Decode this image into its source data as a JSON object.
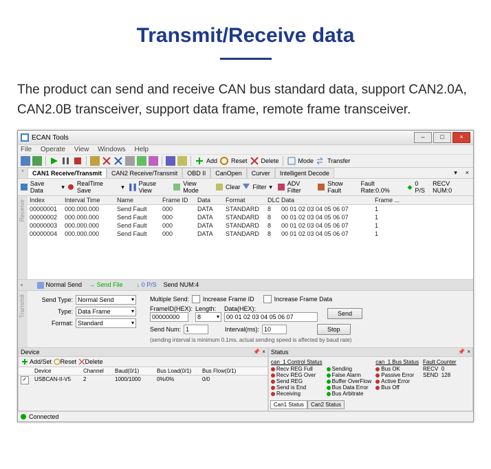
{
  "page": {
    "title": "Transmit/Receive data",
    "desc": "The product can send and receive CAN bus standard data, support CAN2.0A, CAN2.0B transceiver, support data frame, remote frame transceiver."
  },
  "window": {
    "title": "ECAN Tools"
  },
  "menu": [
    "File",
    "Operate",
    "View",
    "Windows",
    "Help"
  ],
  "toolbar": {
    "add": "Add",
    "reset": "Reset",
    "delete": "Delete",
    "mode": "Mode",
    "transfer": "Transfer"
  },
  "maintabs": [
    "CAN1 Receive/Transmit",
    "CAN2 Receive/Transmit",
    "OBD II",
    "CanOpen",
    "Curver",
    "Intelligent Decode"
  ],
  "tb2": {
    "save": "Save Data",
    "rtsave": "RealTime Save",
    "pause": "Pause View",
    "viewmode": "View Mode",
    "clear": "Clear",
    "filter": "Filter",
    "adv": "ADV Filter",
    "showfault": "Show Fault",
    "faultrate": "Fault Rate:0.0%",
    "ps": "0 P/S",
    "recv": "RECV NUM:0"
  },
  "gridhdr": [
    "Index",
    "Interval Time",
    "Name",
    "Frame ID",
    "Data",
    "Format",
    "DLC",
    "Data",
    "Frame ..."
  ],
  "rows": [
    {
      "idx": "00000001",
      "time": "000.000.000",
      "name": "Send Fault",
      "fid": "000",
      "data1": "DATA",
      "fmt": "STANDARD",
      "dlc": "8",
      "data2": "00 01 02 03 04 05 06 07",
      "frame": "1"
    },
    {
      "idx": "00000002",
      "time": "000.000.000",
      "name": "Send Fault",
      "fid": "000",
      "data1": "DATA",
      "fmt": "STANDARD",
      "dlc": "8",
      "data2": "00 01 02 03 04 05 06 07",
      "frame": "1"
    },
    {
      "idx": "00000003",
      "time": "000.000.000",
      "name": "Send Fault",
      "fid": "000",
      "data1": "DATA",
      "fmt": "STANDARD",
      "dlc": "8",
      "data2": "00 01 02 03 04 05 06 07",
      "frame": "1"
    },
    {
      "idx": "00000004",
      "time": "000.000.000",
      "name": "Send Fault",
      "fid": "000",
      "data1": "DATA",
      "fmt": "STANDARD",
      "dlc": "8",
      "data2": "00 01 02 03 04 05 06 07",
      "frame": "1"
    }
  ],
  "split": {
    "normal": "Normal Send",
    "sendfile": "Send File",
    "ps": "0 P/S",
    "sendnum": "Send NUM:4"
  },
  "tx": {
    "sendtype_lbl": "Send Type:",
    "sendtype": "Normal Send",
    "type_lbl": "Type:",
    "type": "Data Frame",
    "format_lbl": "Format:",
    "format": "Standard",
    "multiple": "Multiple Send:",
    "inc_fid": "Increase Frame ID",
    "inc_data": "Increase Frame Data",
    "frameid_lbl": "FrameID(HEX):",
    "frameid": "00000000",
    "length_lbl": "Length:",
    "length": "8",
    "data_lbl": "Data(HEX):",
    "data": "00 01 02 03 04 05 06 07",
    "send": "Send",
    "sendnum_lbl": "Send Num:",
    "sendnum": "1",
    "interval_lbl": "Interval(ms):",
    "interval": "10",
    "stop": "Stop",
    "note": "(sending interval is minimum 0.1ms, actual sending speed is affected by baud rate)"
  },
  "device": {
    "title": "Device",
    "add": "Add/Set",
    "reset": "Reset",
    "del": "Delete",
    "hdr": [
      "",
      "Device",
      "Channel",
      "Baud(0/1)",
      "Bus Load(0/1)",
      "Bus Flow(0/1)"
    ],
    "row": {
      "dev": "USBCAN-II-V5",
      "ch": "2",
      "baud": "1000/1000",
      "load": "0%/0%",
      "flow": "0/0"
    }
  },
  "status": {
    "title": "Status",
    "ctrl_hdr": "can_1 Control Status",
    "bus_hdr": "can_1 Bus Status",
    "fault_hdr": "Fault Counter",
    "ctrl": [
      "Recv REG Full",
      "Recv REG Over",
      "Send REG",
      "Send is End",
      "Receiving"
    ],
    "ctrl2": [
      "Sending",
      "False Alarm",
      "Buffer OverFlow",
      "Bus Data Error",
      "Bus Arbitrate"
    ],
    "bus": [
      "Bus OK",
      "Passive Error",
      "Active Error",
      "Bus Off"
    ],
    "recv": "RECV",
    "recv_v": "0",
    "send": "SEND",
    "send_v": "128",
    "tab1": "Can1 Status",
    "tab2": "Can2 Status"
  },
  "statusbar": {
    "connected": "Connected"
  }
}
